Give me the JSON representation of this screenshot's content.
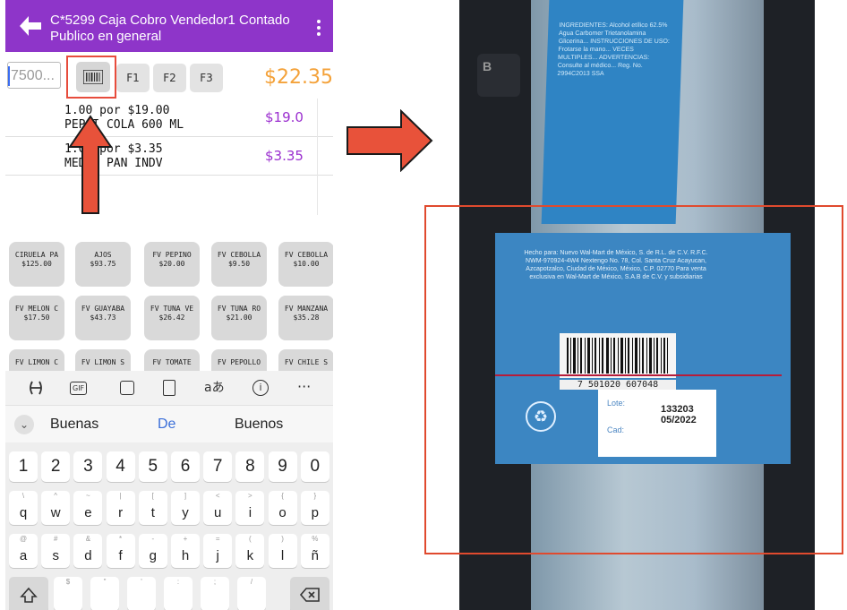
{
  "header": {
    "title": "C*5299 Caja Cobro Vendedor1 Contado",
    "subtitle": "Publico en general"
  },
  "input_row": {
    "qty_placeholder": "7500...",
    "f_buttons": [
      "F1",
      "F2",
      "F3"
    ],
    "total": "$22.35"
  },
  "order_lines": [
    {
      "line1": "1.00 por $19.00",
      "line2": "PEPSI COLA 600 ML",
      "amount": "$19.0"
    },
    {
      "line1": "1.00 por $3.35",
      "line2": "MEDIO PAN INDV",
      "amount": "$3.35"
    }
  ],
  "products": [
    {
      "name": "CIRUELA PA",
      "price": "$125.00"
    },
    {
      "name": "AJOS",
      "price": "$93.75"
    },
    {
      "name": "FV PEPINO",
      "price": "$20.00"
    },
    {
      "name": "FV CEBOLLA",
      "price": "$9.50"
    },
    {
      "name": "FV CEBOLLA",
      "price": "$10.00"
    },
    {
      "name": "FV MELON C",
      "price": "$17.50"
    },
    {
      "name": "FV GUAYABA",
      "price": "$43.73"
    },
    {
      "name": "FV TUNA VE",
      "price": "$26.42"
    },
    {
      "name": "FV TUNA RO",
      "price": "$21.00"
    },
    {
      "name": "FV MANZANA",
      "price": "$35.28"
    },
    {
      "name": "FV LIMON C",
      "price": ""
    },
    {
      "name": "FV LIMON S",
      "price": ""
    },
    {
      "name": "FV TOMATE",
      "price": ""
    },
    {
      "name": "FV PEPOLLO",
      "price": ""
    },
    {
      "name": "FV CHILE S",
      "price": ""
    }
  ],
  "keyboard": {
    "toolbar": [
      "gif-icon",
      "sticker-icon",
      "clipboard-icon",
      "translate-icon",
      "info-icon",
      "more-icon"
    ],
    "suggestions": [
      "Buenas",
      "De",
      "Buenos"
    ],
    "numbers": [
      "1",
      "2",
      "3",
      "4",
      "5",
      "6",
      "7",
      "8",
      "9",
      "0"
    ],
    "row_q": [
      [
        "q",
        "\\"
      ],
      [
        "w",
        "^"
      ],
      [
        "e",
        "~"
      ],
      [
        "r",
        "|"
      ],
      [
        "t",
        "["
      ],
      [
        "y",
        "]"
      ],
      [
        "u",
        "<"
      ],
      [
        "i",
        ">"
      ],
      [
        "o",
        "{"
      ],
      [
        "p",
        "}"
      ]
    ],
    "row_a": [
      [
        "a",
        "@"
      ],
      [
        "s",
        "#"
      ],
      [
        "d",
        "&"
      ],
      [
        "f",
        "*"
      ],
      [
        "g",
        "-"
      ],
      [
        "h",
        "+"
      ],
      [
        "j",
        "="
      ],
      [
        "k",
        "("
      ],
      [
        "l",
        ")"
      ],
      [
        "ñ",
        "%"
      ]
    ],
    "bottom_row": [
      "$",
      "\"",
      "'",
      ":",
      ";",
      "/"
    ]
  },
  "photo_label": {
    "top_text": "INGREDIENTES: Alcohol etílico 62.5% Agua Carbomer Trietanolamina Glicerina... INSTRUCCIONES DE USO: Frotarse la mano... VECES MULTIPLES... ADVERTENCIAS: Consulte al médico... Reg. No. 2994C2013 SSA",
    "key_letter": "B",
    "maker_text": "Hecho para: Nuevo Wal-Mart de México, S. de R.L. de C.V. R.F.C. NWM-970924-4W4 Nextengo No. 78, Col. Santa Cruz Acayucan, Azcapotzalco, Ciudad de México, México, C.P. 02770 Para venta exclusiva en Wal-Mart de México, S.A.B de C.V. y subsidiarias",
    "barcode_number": "7 501020 607048",
    "lote_label": "Lote:",
    "cad_label": "Cad:",
    "lot_value": "133203",
    "cad_value": "05/2022"
  },
  "colors": {
    "appbar": "#8e35c9",
    "total": "#f4a23a",
    "amount": "#9b2fcf",
    "annotation": "#e74c3c"
  }
}
